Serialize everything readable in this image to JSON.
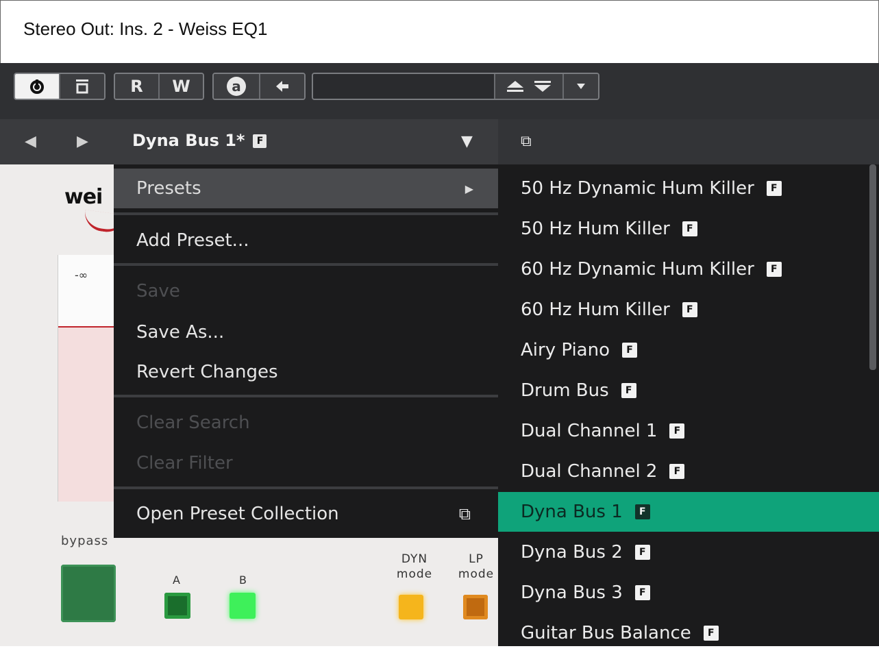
{
  "window": {
    "title": "Stereo Out: Ins. 2 - Weiss EQ1"
  },
  "toolbar": {
    "power_icon": "power-icon",
    "bypass_icon": "bypass-icon",
    "read_label": "R",
    "write_label": "W",
    "auto_label": "a",
    "back_icon": "back-arrow-icon",
    "up_icon": "up-icon",
    "down_icon": "down-icon",
    "dropdown_icon": "chevron-down-icon",
    "text_field_value": ""
  },
  "presetbar": {
    "prev_icon": "◀",
    "next_icon": "▶",
    "preset_name": "Dyna Bus 1*",
    "factory_badge": "F",
    "dropdown_icon": "▼",
    "window_icon": "⧉"
  },
  "plugin": {
    "logo": "wei",
    "meter_level": "-∞",
    "bypass_label": "bypass",
    "label_a": "A",
    "label_b": "B",
    "dyn_label": "DYN\nmode",
    "lp_label": "LP\nmode"
  },
  "menu": {
    "presets": "Presets",
    "add_preset": "Add Preset...",
    "save": "Save",
    "save_as": "Save As...",
    "revert_changes": "Revert Changes",
    "clear_search": "Clear Search",
    "clear_filter": "Clear Filter",
    "open_preset_collection": "Open Preset Collection",
    "submenu_arrow": "▶",
    "window_icon": "⧉"
  },
  "submenu": {
    "badge": "F",
    "items": [
      "50 Hz Dynamic Hum Killer",
      "50 Hz Hum Killer",
      "60 Hz Dynamic Hum Killer",
      "60 Hz Hum Killer",
      "Airy Piano",
      "Drum Bus",
      "Dual Channel 1",
      "Dual Channel 2",
      "Dyna Bus 1",
      "Dyna Bus 2",
      "Dyna Bus 3",
      "Guitar Bus Balance"
    ],
    "selected_index": 8,
    "selected_color": "#0fa37a"
  }
}
